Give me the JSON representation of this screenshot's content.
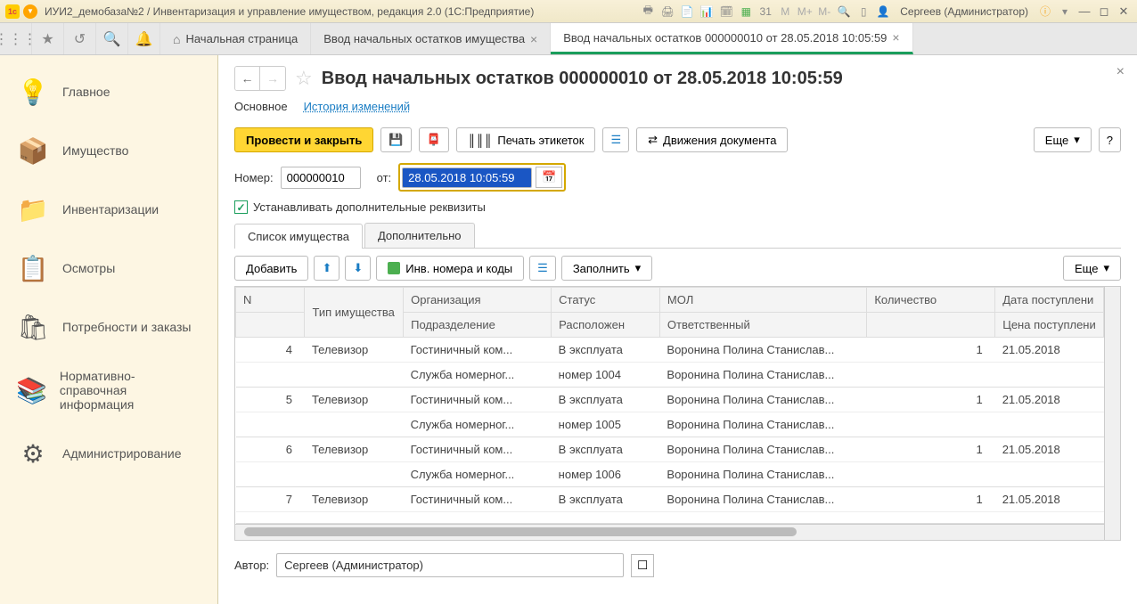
{
  "titlebar": {
    "title": "ИУИ2_демобаза№2 / Инвентаризация и управление имуществом, редакция 2.0  (1С:Предприятие)",
    "user": "Сергеев (Администратор)"
  },
  "tabs": {
    "home": "Начальная страница",
    "t1": "Ввод начальных остатков имущества",
    "t2": "Ввод начальных остатков 000000010 от 28.05.2018 10:05:59"
  },
  "sidebar": {
    "main": "Главное",
    "assets": "Имущество",
    "inv": "Инвентаризации",
    "insp": "Осмотры",
    "needs": "Потребности и заказы",
    "ref": "Нормативно-справочная информация",
    "admin": "Администрирование"
  },
  "doc": {
    "title": "Ввод начальных остатков 000000010 от 28.05.2018 10:05:59",
    "subnav_main": "Основное",
    "subnav_hist": "История изменений",
    "btn_post": "Провести и закрыть",
    "btn_print": "Печать этикеток",
    "btn_moves": "Движения документа",
    "btn_more": "Еще",
    "lbl_num": "Номер:",
    "val_num": "000000010",
    "lbl_from": "от:",
    "val_date": "28.05.2018 10:05:59",
    "chk_label": "Устанавливать дополнительные реквизиты",
    "tab_list": "Список имущества",
    "tab_extra": "Дополнительно",
    "btn_add": "Добавить",
    "btn_codes": "Инв. номера и коды",
    "btn_fill": "Заполнить",
    "author_lbl": "Автор:",
    "author_val": "Сергеев (Администратор)"
  },
  "grid": {
    "h_n": "N",
    "h_type": "Тип имущества",
    "h_org": "Организация",
    "h_dept": "Подразделение",
    "h_status": "Статус",
    "h_loc": "Расположен",
    "h_mol": "МОЛ",
    "h_resp": "Ответственный",
    "h_qty": "Количество",
    "h_dpost": "Дата поступлени",
    "h_cpost": "Цена поступлени",
    "rows": [
      {
        "n": "4",
        "type": "Телевизор",
        "org": "Гостиничный ком...",
        "dept": "Служба номерног...",
        "status": "В эксплуата",
        "loc": "номер 1004",
        "mol": "Воронина Полина Станислав...",
        "resp": "Воронина Полина Станислав...",
        "qty": "1",
        "date": "21.05.2018"
      },
      {
        "n": "5",
        "type": "Телевизор",
        "org": "Гостиничный ком...",
        "dept": "Служба номерног...",
        "status": "В эксплуата",
        "loc": "номер 1005",
        "mol": "Воронина Полина Станислав...",
        "resp": "Воронина Полина Станислав...",
        "qty": "1",
        "date": "21.05.2018"
      },
      {
        "n": "6",
        "type": "Телевизор",
        "org": "Гостиничный ком...",
        "dept": "Служба номерног...",
        "status": "В эксплуата",
        "loc": "номер 1006",
        "mol": "Воронина Полина Станислав...",
        "resp": "Воронина Полина Станислав...",
        "qty": "1",
        "date": "21.05.2018"
      },
      {
        "n": "7",
        "type": "Телевизор",
        "org": "Гостиничный ком...",
        "dept": "",
        "status": "В эксплуата",
        "loc": "",
        "mol": "Воронина Полина Станислав...",
        "resp": "",
        "qty": "1",
        "date": "21.05.2018"
      }
    ]
  }
}
